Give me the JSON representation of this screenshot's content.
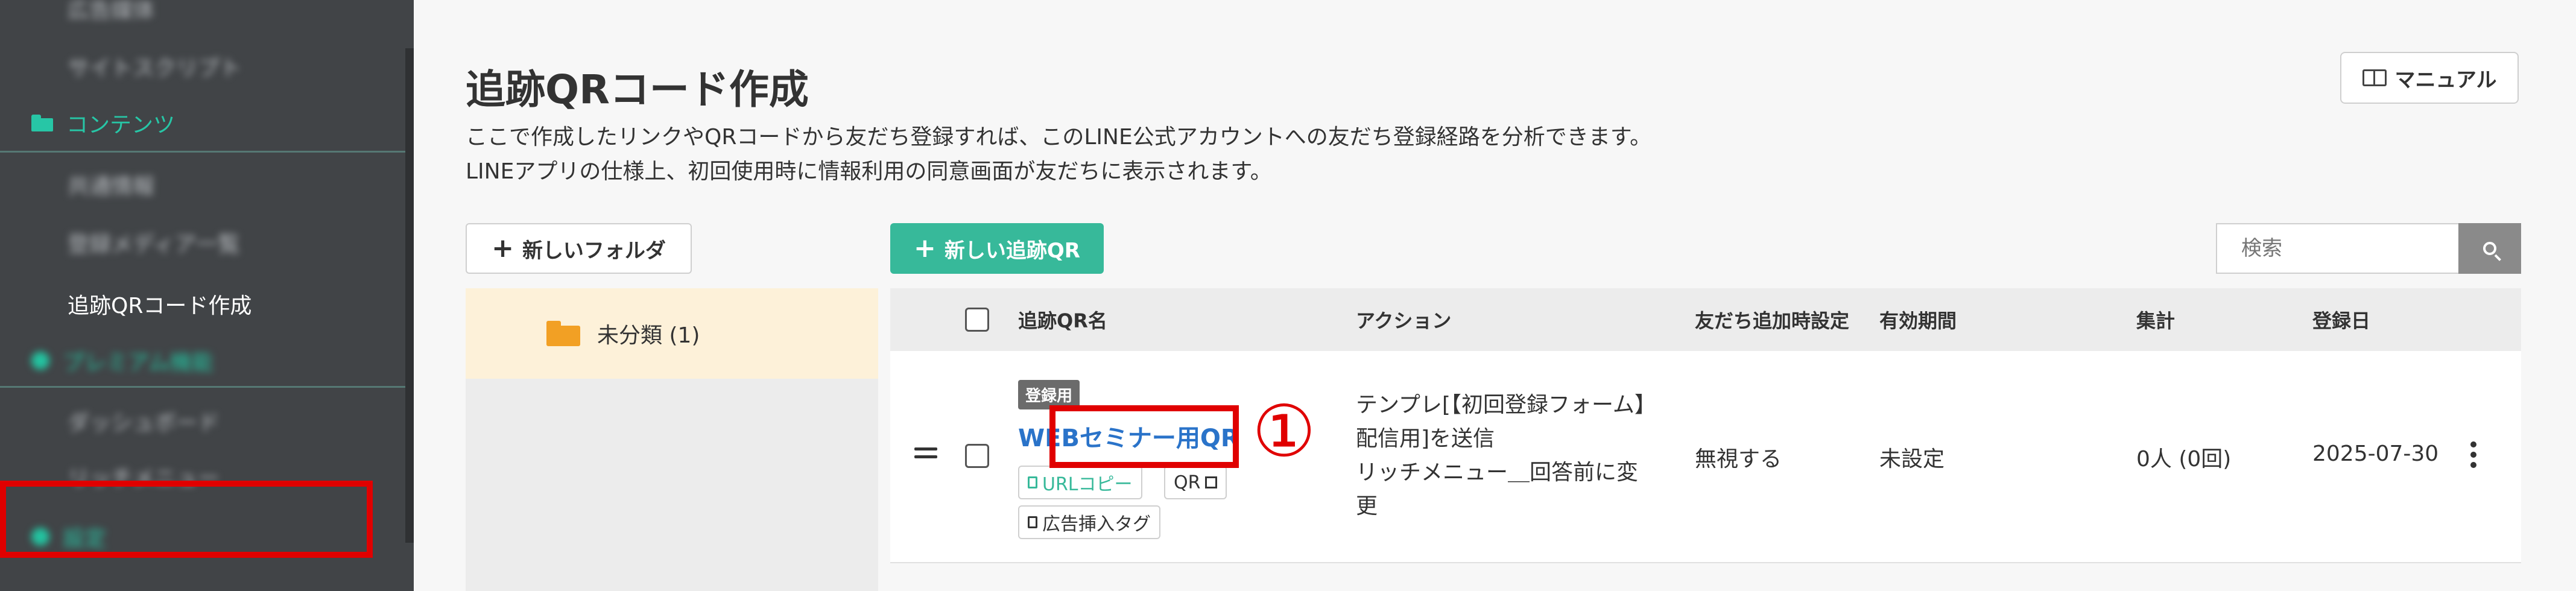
{
  "sidebar": {
    "items": [
      {
        "label": "広告媒体",
        "blurred": true
      },
      {
        "label": "サイトスクリプト",
        "blurred": true
      },
      {
        "label": "共通情報",
        "blurred": true
      },
      {
        "label": "登録メディア一覧",
        "blurred": true
      },
      {
        "label": "追跡QRコード作成",
        "blurred": false
      },
      {
        "label": "ダッシュボード",
        "blurred": true
      },
      {
        "label": "リッチメニュー",
        "blurred": true
      }
    ],
    "section_content": "コンテンツ",
    "section_premium": "プレミアム機能",
    "section_settings": "設定"
  },
  "header": {
    "title": "追跡QRコード作成",
    "desc_line1": "ここで作成したリンクやQRコードから友だち登録すれば、このLINE公式アカウントへの友だち登録経路を分析できます。",
    "desc_line2": "LINEアプリの仕様上、初回使用時に情報利用の同意画面が友だちに表示されます。",
    "manual_label": "マニュアル"
  },
  "toolbar": {
    "new_folder_label": "新しいフォルダ",
    "new_qr_label": "新しい追跡QR",
    "search_placeholder": "検索"
  },
  "folders": [
    {
      "label": "未分類 (1)"
    }
  ],
  "table": {
    "columns": [
      "追跡QR名",
      "アクション",
      "友だち追加時設定",
      "有効期間",
      "集計",
      "登録日"
    ],
    "rows": [
      {
        "badge": "登録用",
        "name": "WEBセミナー用QR",
        "url_copy": "URLコピー",
        "qr": "QR",
        "ad_tag": "広告挿入タグ",
        "action_lines": [
          "テンプレ[【初回登録フォーム】",
          "配信用]を送信",
          "リッチメニュー＿回答前に変",
          "更"
        ],
        "friend_setting": "無視する",
        "period": "未設定",
        "total": "0人 (0回)",
        "date": "2025-07-30"
      }
    ]
  },
  "annotation": {
    "marker": "①",
    "color": "#e00000"
  },
  "colors": {
    "accent": "#37b99a",
    "link": "#2a73c9",
    "sidebar_bg": "#414447",
    "folder_selected_bg": "#fdf1d9"
  }
}
